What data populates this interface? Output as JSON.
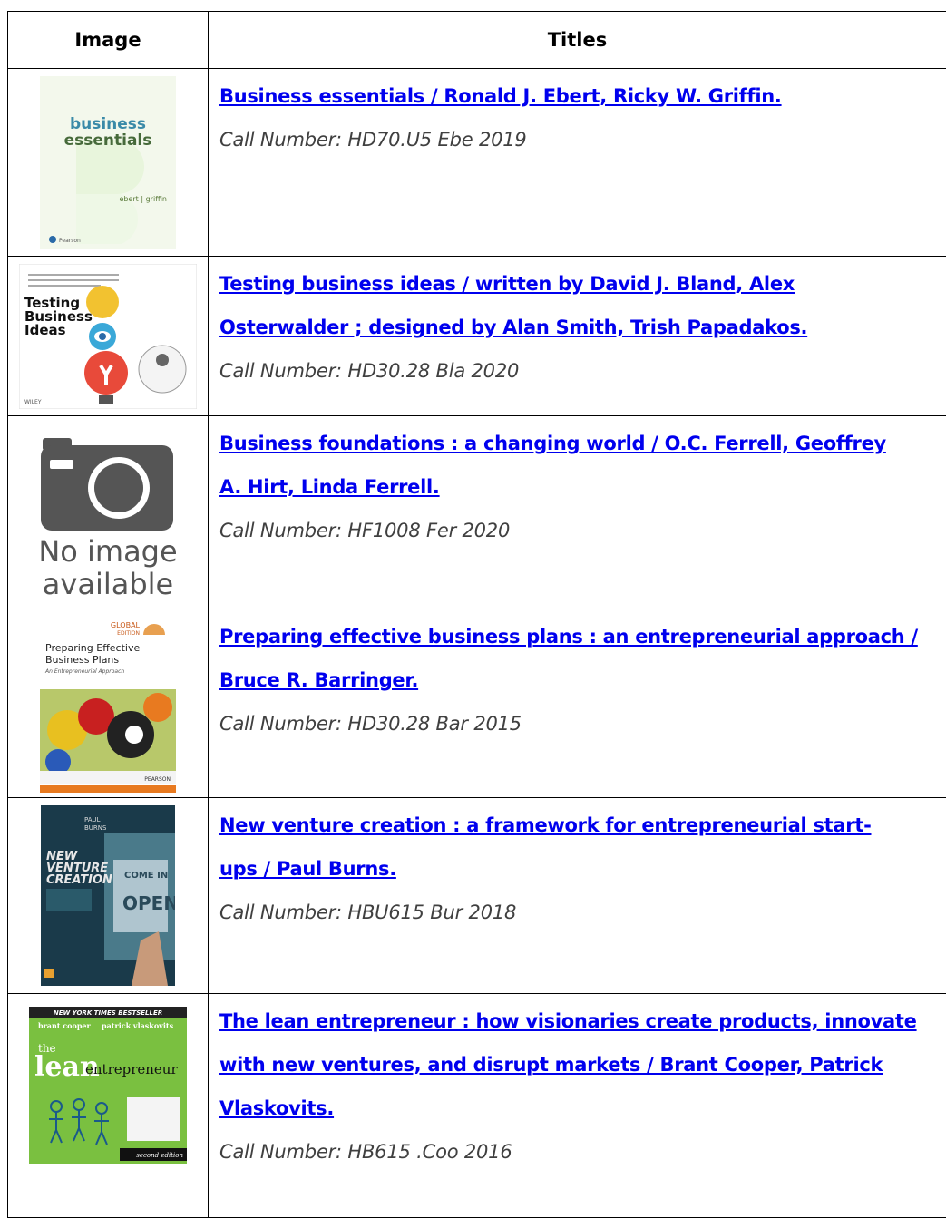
{
  "table": {
    "header_image": "Image",
    "header_titles": "Titles"
  },
  "books": [
    {
      "title": "Business essentials / Ronald J. Ebert, Ricky W. Griffin.",
      "call_number": "Call Number: HD70.U5 Ebe 2019",
      "cover_text": [
        "business",
        "essentials",
        "ebert | griffin",
        "Pearson"
      ]
    },
    {
      "title": "Testing business ideas / written by David J. Bland, Alex Osterwalder ; designed by Alan Smith, Trish Papadakos.",
      "call_number": "Call Number: HD30.28 Bla 2020",
      "cover_text": [
        "Testing",
        "Business",
        "Ideas",
        "WILEY"
      ]
    },
    {
      "title": "Business foundations : a changing world / O.C. Ferrell, Geoffrey A. Hirt, Linda Ferrell.",
      "call_number": "Call Number: HF1008 Fer 2020",
      "cover_text": [
        "No image",
        "available"
      ]
    },
    {
      "title": "Preparing effective business plans : an entrepreneurial approach / Bruce R. Barringer.",
      "call_number": "Call Number: HD30.28 Bar 2015",
      "cover_text": [
        "GLOBAL",
        "EDITION",
        "Preparing Effective",
        "Business Plans",
        "An Entrepreneurial Approach",
        "PEARSON"
      ]
    },
    {
      "title": "New venture creation : a framework for entrepreneurial start-ups / Paul Burns.",
      "call_number": "Call Number: HBU615 Bur 2018",
      "cover_text": [
        "PAUL",
        "BURNS",
        "NEW",
        "VENTURE",
        "CREATION",
        "COME IN",
        "OPEN"
      ]
    },
    {
      "title": "The lean entrepreneur : how visionaries create products, innovate with new ventures, and disrupt markets / Brant Cooper, Patrick Vlaskovits.",
      "call_number": "Call Number: HB615 .Coo 2016",
      "cover_text": [
        "NEW YORK TIMES BESTSELLER",
        "brant cooper",
        "patrick vlaskovits",
        "the",
        "lean",
        "entrepreneur",
        "second edition"
      ]
    }
  ]
}
